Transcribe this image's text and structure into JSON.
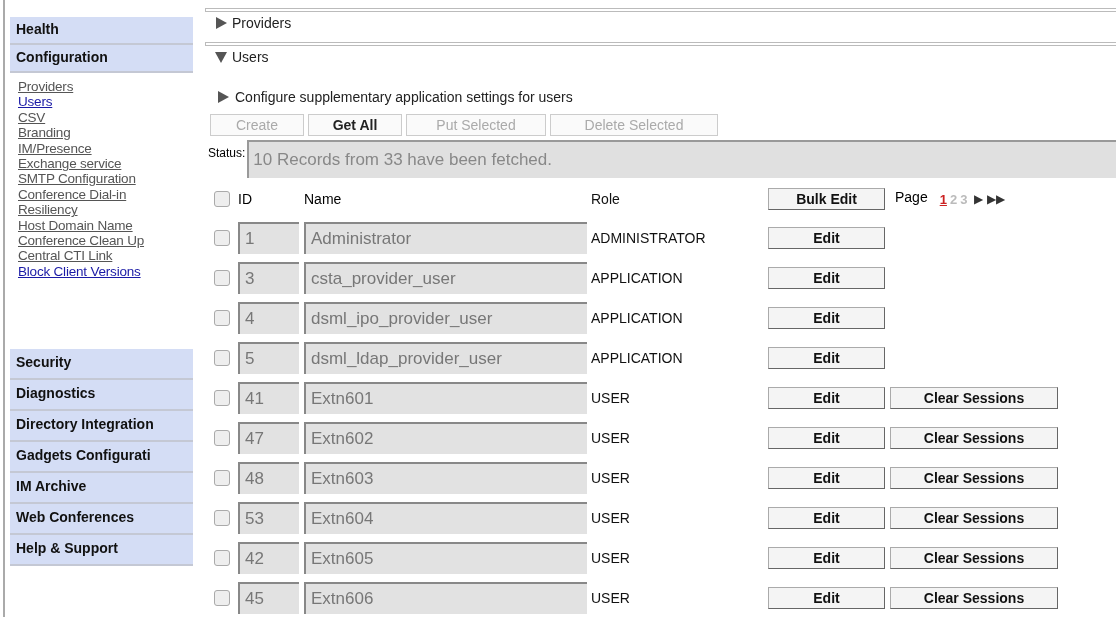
{
  "sidebar": {
    "sections_top": [
      {
        "label": "Health"
      },
      {
        "label": "Configuration",
        "links": [
          {
            "label": "Providers",
            "visited": true
          },
          {
            "label": "Users",
            "visited": false
          },
          {
            "label": "CSV",
            "visited": true
          },
          {
            "label": "Branding",
            "visited": true
          },
          {
            "label": "IM/Presence",
            "visited": true
          },
          {
            "label": "Exchange service",
            "visited": true
          },
          {
            "label": "SMTP Configuration",
            "visited": true
          },
          {
            "label": "Conference Dial-in",
            "visited": true
          },
          {
            "label": "Resiliency",
            "visited": true
          },
          {
            "label": "Host Domain Name",
            "visited": true
          },
          {
            "label": "Conference Clean Up",
            "visited": true
          },
          {
            "label": "Central CTI Link",
            "visited": true
          },
          {
            "label": "Block Client Versions",
            "visited": false
          }
        ]
      }
    ],
    "sections_bottom": [
      {
        "label": "Security"
      },
      {
        "label": "Diagnostics"
      },
      {
        "label": "Directory Integration"
      },
      {
        "label": "Gadgets Configurati"
      },
      {
        "label": "IM Archive"
      },
      {
        "label": "Web Conferences"
      },
      {
        "label": "Help & Support"
      }
    ]
  },
  "panels": [
    {
      "title": "Providers",
      "expanded": false
    },
    {
      "title": "Users",
      "expanded": true
    }
  ],
  "supplementary": {
    "label": "Configure supplementary application settings for users",
    "expanded": false
  },
  "toolbar": [
    {
      "label": "Create",
      "disabled": true
    },
    {
      "label": "Get All",
      "disabled": false
    },
    {
      "label": "Put Selected",
      "disabled": true
    },
    {
      "label": "Delete Selected",
      "disabled": true
    }
  ],
  "status": {
    "label": "Status:",
    "value": "10 Records from 33 have been fetched."
  },
  "table": {
    "select_all": false,
    "columns": [
      "ID",
      "Name",
      "Role"
    ],
    "bulk_edit": "Bulk Edit",
    "page_label": "Page",
    "pages": [
      {
        "label": "1",
        "selected": true
      },
      {
        "label": "2",
        "selected": false
      },
      {
        "label": "3",
        "selected": false
      }
    ],
    "next": "▶",
    "last": "▶▶",
    "rows": [
      {
        "checked": false,
        "id": "1",
        "name": "Administrator",
        "role": "ADMINISTRATOR",
        "edit": "Edit"
      },
      {
        "checked": false,
        "id": "3",
        "name": "csta_provider_user",
        "role": "APPLICATION",
        "edit": "Edit"
      },
      {
        "checked": false,
        "id": "4",
        "name": "dsml_ipo_provider_user",
        "role": "APPLICATION",
        "edit": "Edit"
      },
      {
        "checked": false,
        "id": "5",
        "name": "dsml_ldap_provider_user",
        "role": "APPLICATION",
        "edit": "Edit"
      },
      {
        "checked": false,
        "id": "41",
        "name": "Extn601",
        "role": "USER",
        "edit": "Edit",
        "clear": "Clear Sessions"
      },
      {
        "checked": false,
        "id": "47",
        "name": "Extn602",
        "role": "USER",
        "edit": "Edit",
        "clear": "Clear Sessions"
      },
      {
        "checked": false,
        "id": "48",
        "name": "Extn603",
        "role": "USER",
        "edit": "Edit",
        "clear": "Clear Sessions"
      },
      {
        "checked": false,
        "id": "53",
        "name": "Extn604",
        "role": "USER",
        "edit": "Edit",
        "clear": "Clear Sessions"
      },
      {
        "checked": false,
        "id": "42",
        "name": "Extn605",
        "role": "USER",
        "edit": "Edit",
        "clear": "Clear Sessions"
      },
      {
        "checked": false,
        "id": "45",
        "name": "Extn606",
        "role": "USER",
        "edit": "Edit",
        "clear": "Clear Sessions"
      }
    ]
  }
}
